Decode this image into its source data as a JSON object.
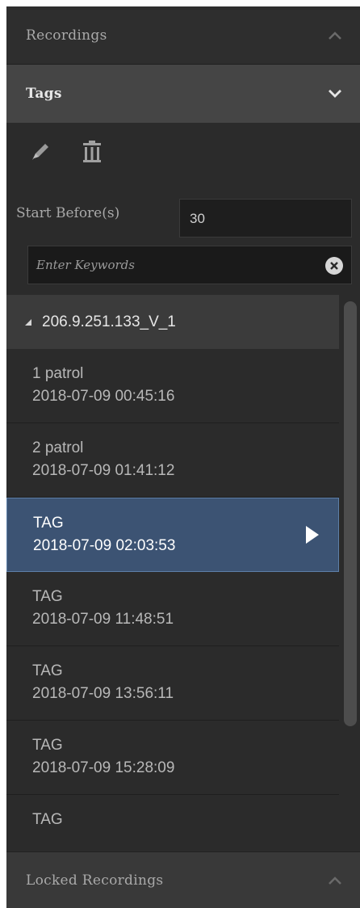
{
  "sections": {
    "recordings": "Recordings",
    "tags": "Tags",
    "locked": "Locked Recordings"
  },
  "start_before": {
    "label": "Start Before(s)",
    "value": "30"
  },
  "search": {
    "placeholder": "Enter Keywords"
  },
  "group": {
    "label": "206.9.251.133_V_1"
  },
  "items": [
    {
      "name": "1 patrol",
      "time": "2018-07-09 00:45:16"
    },
    {
      "name": "2 patrol",
      "time": "2018-07-09 01:41:12"
    },
    {
      "name": "TAG",
      "time": "2018-07-09 02:03:53"
    },
    {
      "name": "TAG",
      "time": "2018-07-09 11:48:51"
    },
    {
      "name": "TAG",
      "time": "2018-07-09 13:56:11"
    },
    {
      "name": "TAG",
      "time": "2018-07-09 15:28:09"
    },
    {
      "name": "TAG",
      "time": ""
    }
  ],
  "icons": {
    "recordings_toggle": "chevron-up-icon",
    "tags_toggle": "chevron-down-icon",
    "locked_toggle": "chevron-up-icon",
    "edit": "pencil-icon",
    "delete": "trash-icon",
    "clear": "close-icon",
    "play": "play-icon",
    "collapse": "triangle-icon"
  },
  "colors": {
    "selected_bg": "#3c5373",
    "panel_bg": "#2b2b2b",
    "header_active": "#454545"
  }
}
